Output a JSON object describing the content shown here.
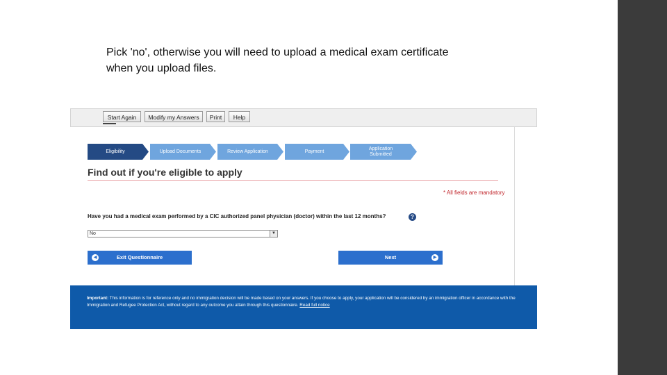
{
  "caption": {
    "text": "Pick 'no', otherwise you will need to upload a medical exam certificate\nwhen you upload files."
  },
  "toolbar": {
    "buttons": [
      "Start Again",
      "Modify my Answers",
      "Print",
      "Help"
    ]
  },
  "progress": {
    "steps": [
      {
        "label": "Eligibility",
        "active": true
      },
      {
        "label": "Upload Documents",
        "active": false
      },
      {
        "label": "Review Application",
        "active": false
      },
      {
        "label": "Payment",
        "active": false
      },
      {
        "label": "Application Submitted",
        "active": false
      }
    ]
  },
  "form": {
    "title": "Find out if you're eligible to apply",
    "mandatory_note": "* All fields are mandatory",
    "question": "Have you had a medical exam performed by a CIC authorized panel physician (doctor) within the last 12 months?",
    "help_icon": "?",
    "select_value": "No",
    "select_arrow": "▼",
    "exit_label": "Exit Questionnaire",
    "next_label": "Next"
  },
  "footer": {
    "important_label": "Important:",
    "text": " This information is for reference only and no immigration decision will be made based on your answers. If you choose to apply, your application will be considered by an immigration officer in accordance with the Immigration and Refugee Protection Act, without regard to any outcome you attain through this questionnaire. ",
    "link": "Read full notice"
  },
  "colors": {
    "active_step": "#244a84",
    "inactive_step": "#6fa5de",
    "button_blue": "#2c6fcd",
    "footer_blue": "#0f5aa9",
    "mandatory_red": "#c1272d"
  }
}
